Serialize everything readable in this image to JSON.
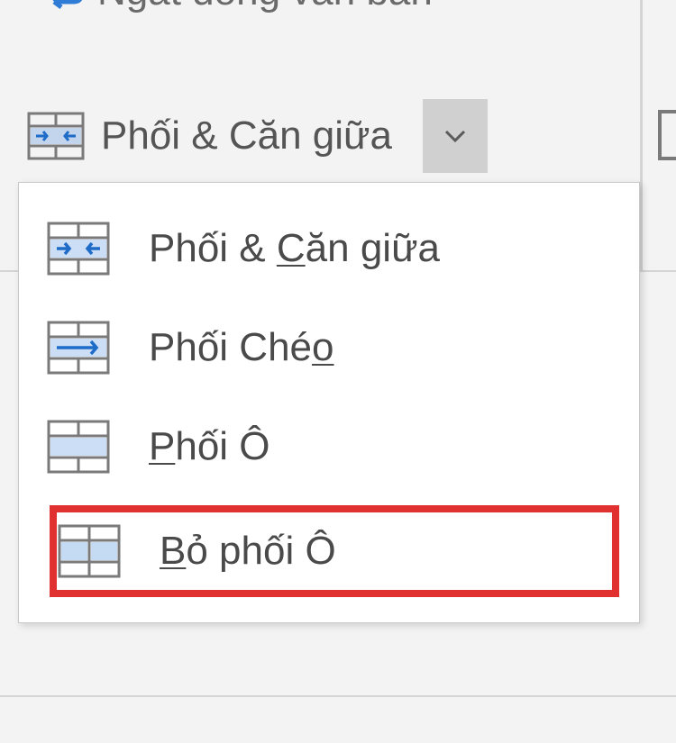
{
  "ribbon": {
    "wrap_text_label": "Ngắt dòng văn bản",
    "merge_center_label": "Phối & Căn giữa"
  },
  "dropdown": {
    "items": [
      {
        "label_pre": "Phối & ",
        "underline": "C",
        "label_post": "ăn giữa"
      },
      {
        "label_pre": "Phối Ché",
        "underline": "o",
        "label_post": ""
      },
      {
        "label_pre": "",
        "underline": "P",
        "label_post": "hối Ô"
      },
      {
        "label_pre": "",
        "underline": "B",
        "label_post": "ỏ phối Ô"
      }
    ]
  }
}
